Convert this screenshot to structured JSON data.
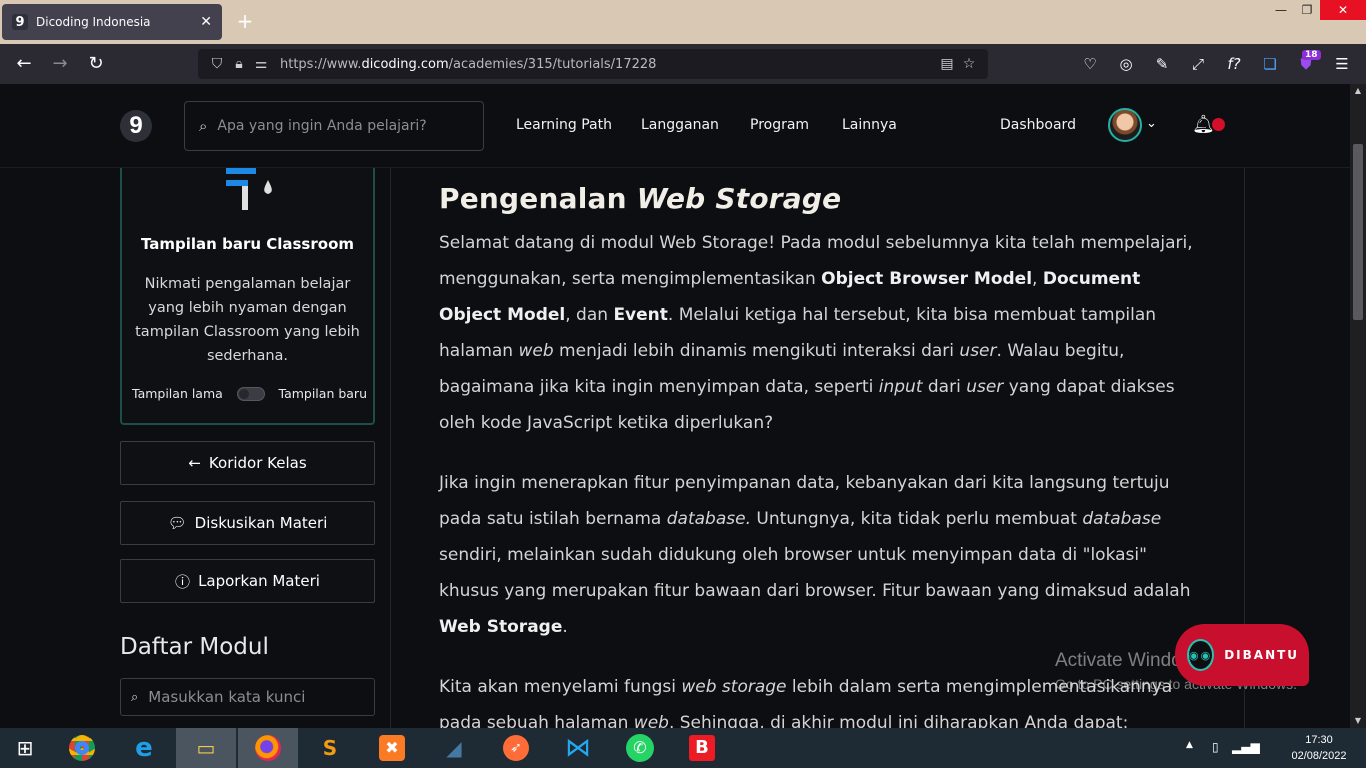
{
  "browser": {
    "tab_title": "Dicoding Indonesia",
    "tab_favicon": "9",
    "url_prefix": "https://www.",
    "url_domain": "dicoding.com",
    "url_path": "/academies/315/tutorials/17228",
    "extension_badge": "18"
  },
  "header": {
    "logo": "9",
    "search_placeholder": "Apa yang ingin Anda pelajari?",
    "nav": [
      "Learning Path",
      "Langganan",
      "Program",
      "Lainnya"
    ],
    "dashboard": "Dashboard"
  },
  "sidebar": {
    "card_title": "Tampilan baru Classroom",
    "card_desc": "Nikmati pengalaman belajar yang lebih nyaman dengan tampilan Classroom yang lebih sederhana.",
    "toggle_left": "Tampilan lama",
    "toggle_right": "Tampilan baru",
    "btn_koridor": "Koridor Kelas",
    "btn_diskusi": "Diskusikan Materi",
    "btn_lapor": "Laporkan Materi",
    "modul_title": "Daftar Modul",
    "modul_search_placeholder": "Masukkan kata kunci"
  },
  "article": {
    "title_plain": "Pengenalan ",
    "title_italic": "Web Storage"
  },
  "overlay": {
    "activate_title": "Activate Windows",
    "activate_sub": "Go to PC settings to activate Windows.",
    "dibantu": "DIBANTU"
  },
  "taskbar": {
    "time": "17:30",
    "date": "02/08/2022"
  },
  "colors": {
    "accent_teal": "#23b1a5",
    "notif_red": "#d40f2a",
    "page_bg": "#0d0e12"
  }
}
